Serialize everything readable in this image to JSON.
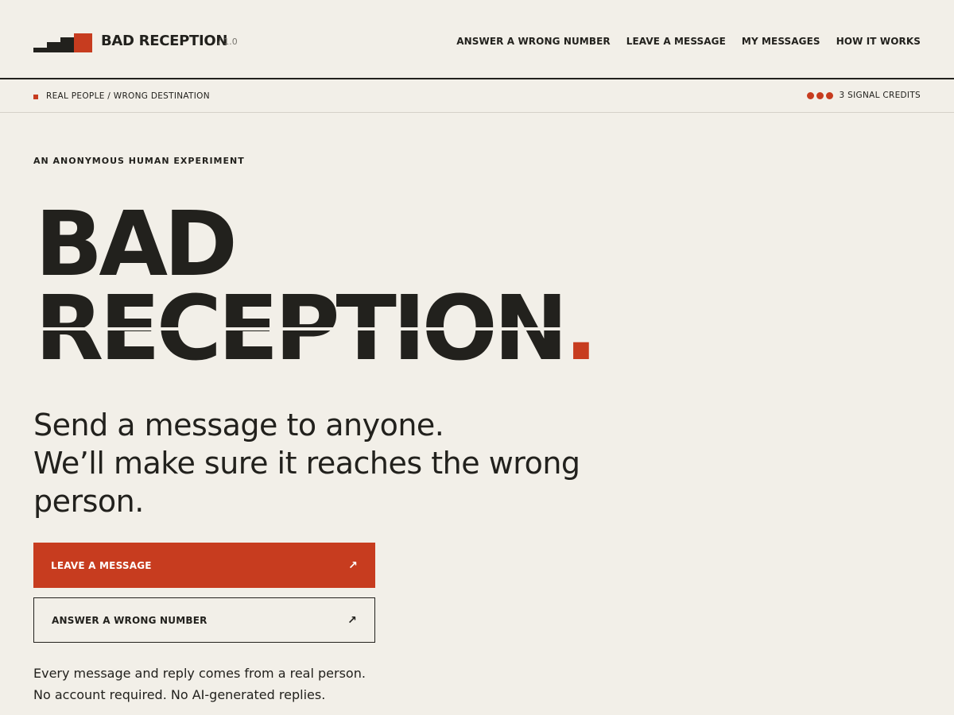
{
  "header": {
    "brand": "BAD RECEPTION",
    "version": "/ 1.0",
    "nav": [
      {
        "label": "ANSWER A WRONG NUMBER"
      },
      {
        "label": "LEAVE A MESSAGE"
      },
      {
        "label": "MY MESSAGES"
      },
      {
        "label": "HOW IT WORKS"
      }
    ]
  },
  "subbar": {
    "tagline": "REAL PEOPLE / WRONG DESTINATION",
    "credits_label": "3 SIGNAL CREDITS",
    "credits_count": 3
  },
  "hero": {
    "eyebrow": "AN ANONYMOUS HUMAN EXPERIMENT",
    "title_line1": "BAD",
    "title_line2": "RECEPTION",
    "title_period": ".",
    "tagline_line1": "Send a message to anyone.",
    "tagline_line2": "We’ll make sure it reaches the wrong person."
  },
  "actions": {
    "primary_label": "LEAVE A MESSAGE",
    "secondary_label": "ANSWER A WRONG NUMBER",
    "arrow": "↗"
  },
  "footnote": {
    "line1": "Every message and reply comes from a real person.",
    "line2": "No account required. No AI-generated replies."
  },
  "colors": {
    "background": "#f2efe8",
    "ink": "#22211d",
    "accent": "#c73c1f"
  }
}
